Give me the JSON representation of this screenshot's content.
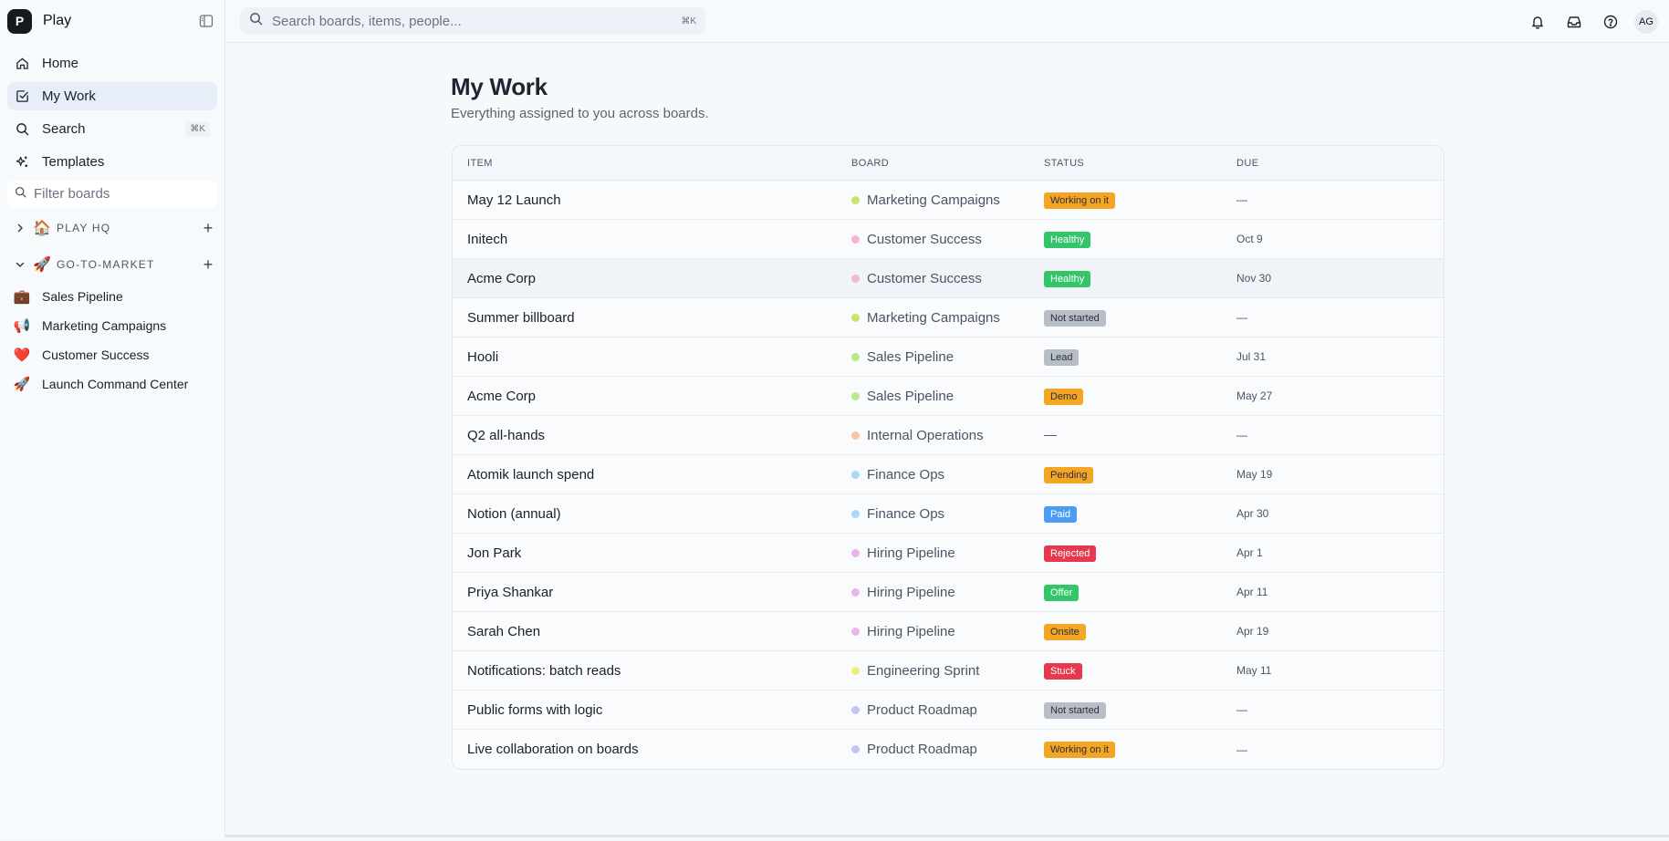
{
  "app": {
    "logo_letter": "P",
    "name": "Play"
  },
  "sidebar": {
    "nav": [
      {
        "label": "Home",
        "icon": "home-icon"
      },
      {
        "label": "My Work",
        "icon": "check-square-icon"
      },
      {
        "label": "Search",
        "icon": "search-icon",
        "shortcut": "⌘K"
      },
      {
        "label": "Templates",
        "icon": "sparkle-icon"
      }
    ],
    "filter_placeholder": "Filter boards",
    "workspaces": [
      {
        "name": "PLAY HQ",
        "emoji": "🏠",
        "expanded": false
      },
      {
        "name": "GO-TO-MARKET",
        "emoji": "🚀",
        "expanded": true
      }
    ],
    "boards": [
      {
        "label": "Sales Pipeline",
        "emoji": "💼"
      },
      {
        "label": "Marketing Campaigns",
        "emoji": "📢"
      },
      {
        "label": "Customer Success",
        "emoji": "❤️"
      },
      {
        "label": "Launch Command Center",
        "emoji": "🚀"
      }
    ]
  },
  "topbar": {
    "search_placeholder": "Search boards, items, people...",
    "search_shortcut": "⌘K",
    "avatar_initials": "AG"
  },
  "main": {
    "title": "My Work",
    "subtitle": "Everything assigned to you across boards.",
    "columns": [
      "ITEM",
      "BOARD",
      "STATUS",
      "DUE"
    ],
    "rows": [
      {
        "item": "May 12 Launch",
        "board": "Marketing Campaigns",
        "dot": "#c9e66b",
        "status": "Working on it",
        "status_color": "#f5a524",
        "due": "—"
      },
      {
        "item": "Initech",
        "board": "Customer Success",
        "dot": "#f3b7cf",
        "status": "Healthy",
        "status_color": "#34c46a",
        "due": "Oct 9"
      },
      {
        "item": "Acme Corp",
        "board": "Customer Success",
        "dot": "#f3b7cf",
        "status": "Healthy",
        "status_color": "#34c46a",
        "due": "Nov 30"
      },
      {
        "item": "Summer billboard",
        "board": "Marketing Campaigns",
        "dot": "#c9e66b",
        "status": "Not started",
        "status_color": "#b8bec8",
        "due": "—"
      },
      {
        "item": "Hooli",
        "board": "Sales Pipeline",
        "dot": "#b5e98a",
        "status": "Lead",
        "status_color": "#b8bec8",
        "due": "Jul 31"
      },
      {
        "item": "Acme Corp",
        "board": "Sales Pipeline",
        "dot": "#b5e98a",
        "status": "Demo",
        "status_color": "#f5a524",
        "due": "May 27"
      },
      {
        "item": "Q2 all-hands",
        "board": "Internal Operations",
        "dot": "#f7c4a0",
        "status": "—",
        "status_color": "",
        "due": "—"
      },
      {
        "item": "Atomik launch spend",
        "board": "Finance Ops",
        "dot": "#a8d8f5",
        "status": "Pending",
        "status_color": "#f5a524",
        "due": "May 19"
      },
      {
        "item": "Notion (annual)",
        "board": "Finance Ops",
        "dot": "#a8d8f5",
        "status": "Paid",
        "status_color": "#4a9df0",
        "due": "Apr 30"
      },
      {
        "item": "Jon Park",
        "board": "Hiring Pipeline",
        "dot": "#e7b6ec",
        "status": "Rejected",
        "status_color": "#e5394f",
        "due": "Apr 1"
      },
      {
        "item": "Priya Shankar",
        "board": "Hiring Pipeline",
        "dot": "#e7b6ec",
        "status": "Offer",
        "status_color": "#34c46a",
        "due": "Apr 11"
      },
      {
        "item": "Sarah Chen",
        "board": "Hiring Pipeline",
        "dot": "#e7b6ec",
        "status": "Onsite",
        "status_color": "#f5a524",
        "due": "Apr 19"
      },
      {
        "item": "Notifications: batch reads",
        "board": "Engineering Sprint",
        "dot": "#eef07a",
        "status": "Stuck",
        "status_color": "#e5394f",
        "due": "May 11"
      },
      {
        "item": "Public forms with logic",
        "board": "Product Roadmap",
        "dot": "#c6c4f5",
        "status": "Not started",
        "status_color": "#b8bec8",
        "due": "—"
      },
      {
        "item": "Live collaboration on boards",
        "board": "Product Roadmap",
        "dot": "#c6c4f5",
        "status": "Working on it",
        "status_color": "#f5a524",
        "due": "—"
      }
    ]
  }
}
